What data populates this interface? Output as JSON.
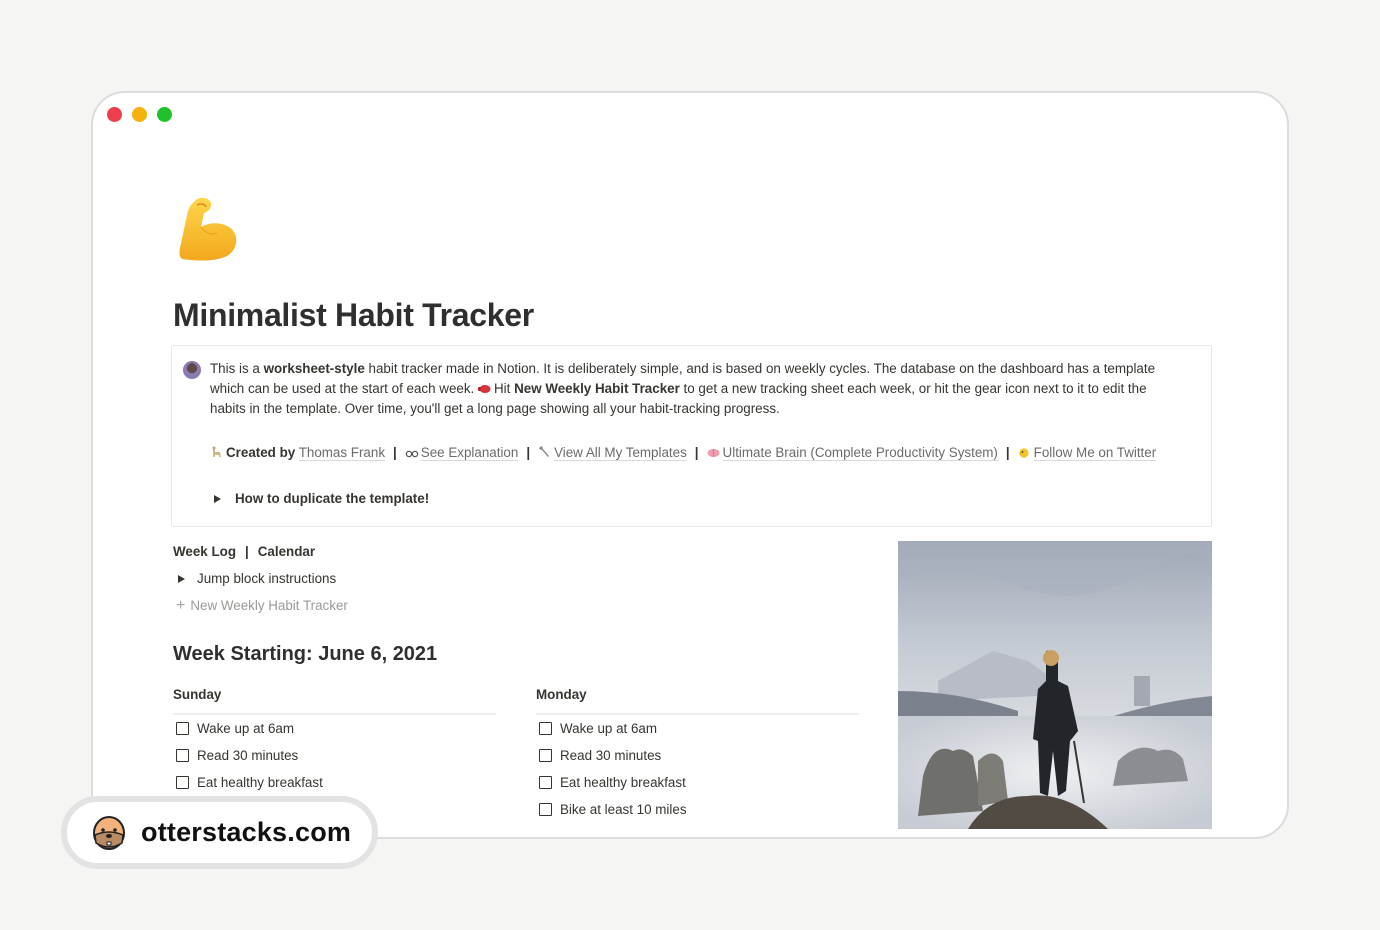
{
  "window": {
    "controls": [
      "close",
      "minimize",
      "maximize"
    ],
    "colors": {
      "close": "#ee3d4b",
      "minimize": "#f5b20d",
      "maximize": "#1fc12d"
    }
  },
  "page": {
    "icon": "flexed-biceps-icon",
    "title": "Minimalist Habit Tracker"
  },
  "callout": {
    "avatar": "author-avatar",
    "text": {
      "p1_a": "This is a ",
      "p1_bold": "worksheet-style",
      "p1_b": " habit tracker made in Notion. It is deliberately simple, and is based on weekly cycles. The database on the dashboard has a template which can be used at the start of each week. ",
      "p1_emoji": "boxing-glove-icon",
      "p1_c": "Hit ",
      "p1_bold2": "New Weekly Habit Tracker",
      "p1_d": " to get a new tracking sheet each week, or hit the gear icon next to it to edit the habits in the template. Over time, you'll get a long page showing all your habit-tracking progress."
    },
    "links": {
      "created_by_label": "Created by",
      "author": "Thomas Frank",
      "see_explanation": "See Explanation",
      "view_templates": "View All My Templates",
      "ultimate_brain": "Ultimate Brain (Complete Productivity System)",
      "follow": "Follow Me on Twitter",
      "separator": "|"
    },
    "toggle": "How to duplicate the template!"
  },
  "nav": {
    "week_log": "Week Log",
    "calendar": "Calendar",
    "separator": "|"
  },
  "jump_toggle": "Jump block instructions",
  "new_button": "New Weekly Habit Tracker",
  "week_heading": "Week Starting: June 6, 2021",
  "days": [
    {
      "name": "Sunday",
      "habits": [
        "Wake up at 6am",
        "Read 30 minutes",
        "Eat healthy breakfast"
      ]
    },
    {
      "name": "Monday",
      "habits": [
        "Wake up at 6am",
        "Read 30 minutes",
        "Eat healthy breakfast",
        "Bike at least 10 miles"
      ]
    }
  ],
  "image": {
    "alt": "Wanderer above the Sea of Fog painting"
  },
  "badge": {
    "text": "otterstacks.com"
  }
}
